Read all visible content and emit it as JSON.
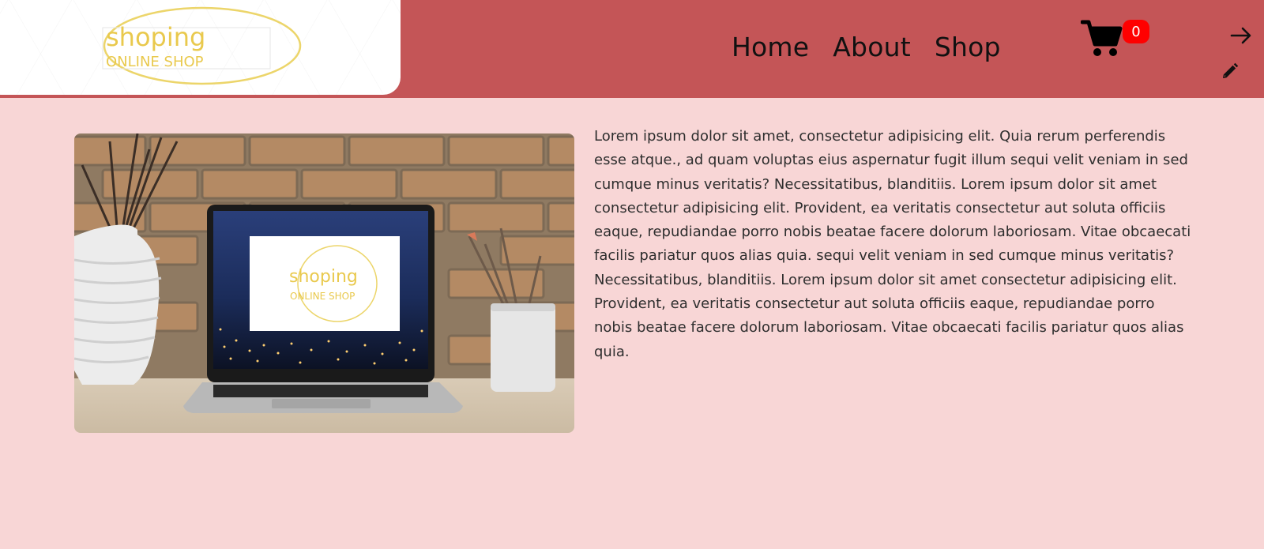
{
  "header": {
    "logo": {
      "brand": "shoping",
      "tagline": "ONLINE SHOP"
    },
    "nav": [
      {
        "label": "Home"
      },
      {
        "label": "About"
      },
      {
        "label": "Shop"
      }
    ],
    "cart": {
      "icon": "cart-icon",
      "count": "0"
    },
    "actions": [
      {
        "icon": "arrow-right-icon"
      },
      {
        "icon": "pencil-icon"
      }
    ]
  },
  "main": {
    "image": {
      "screen_logo_brand": "shoping",
      "screen_logo_tagline": "ONLINE SHOP"
    },
    "paragraph": "Lorem ipsum dolor sit amet, consectetur adipisicing elit. Quia rerum perferendis esse atque., ad quam voluptas eius aspernatur fugit illum sequi velit veniam in sed cumque minus veritatis? Necessitatibus, blanditiis. Lorem ipsum dolor sit amet consectetur adipisicing elit. Provident, ea veritatis consectetur aut soluta officiis eaque, repudiandae porro nobis beatae facere dolorum laboriosam. Vitae obcaecati facilis pariatur quos alias quia. sequi velit veniam in sed cumque minus veritatis? Necessitatibus, blanditiis. Lorem ipsum dolor sit amet consectetur adipisicing elit. Provident, ea veritatis consectetur aut soluta officiis eaque, repudiandae porro nobis beatae facere dolorum laboriosam. Vitae obcaecati facilis pariatur quos alias quia."
  },
  "colors": {
    "header_bg": "#c45557",
    "page_bg": "#f8d6d6",
    "logo_gold": "#e9c94d",
    "badge": "#ff0000"
  }
}
